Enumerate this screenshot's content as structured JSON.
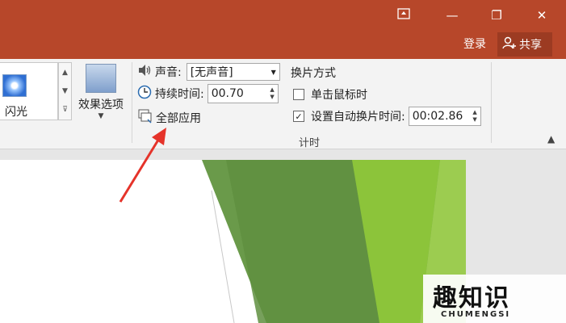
{
  "window": {
    "ribbon_display_icon": "ribbon-display-icon",
    "minimize_glyph": "—",
    "restore_glyph": "❐",
    "close_glyph": "✕"
  },
  "account": {
    "login_label": "登录",
    "share_label": "共享"
  },
  "transition_gallery": {
    "selected_effect": "闪光"
  },
  "effect_options": {
    "label": "效果选项"
  },
  "timing": {
    "sound_label": "声音:",
    "sound_value": "[无声音]",
    "duration_label": "持续时间:",
    "duration_value": "00.70",
    "apply_all_label": "全部应用",
    "advance_heading": "换片方式",
    "on_click_label": "单击鼠标时",
    "on_click_checked": false,
    "after_label": "设置自动换片时间:",
    "after_checked": true,
    "after_value": "00:02.86",
    "group_label": "计时"
  },
  "colors": {
    "titlebar": "#b7472a",
    "slide_green_dark": "#6a9a4a",
    "slide_green_light": "#8cc43a",
    "annotation_arrow": "#e5332a"
  },
  "watermark": {
    "cn": "趣知识",
    "en": "CHUMENGSI"
  }
}
